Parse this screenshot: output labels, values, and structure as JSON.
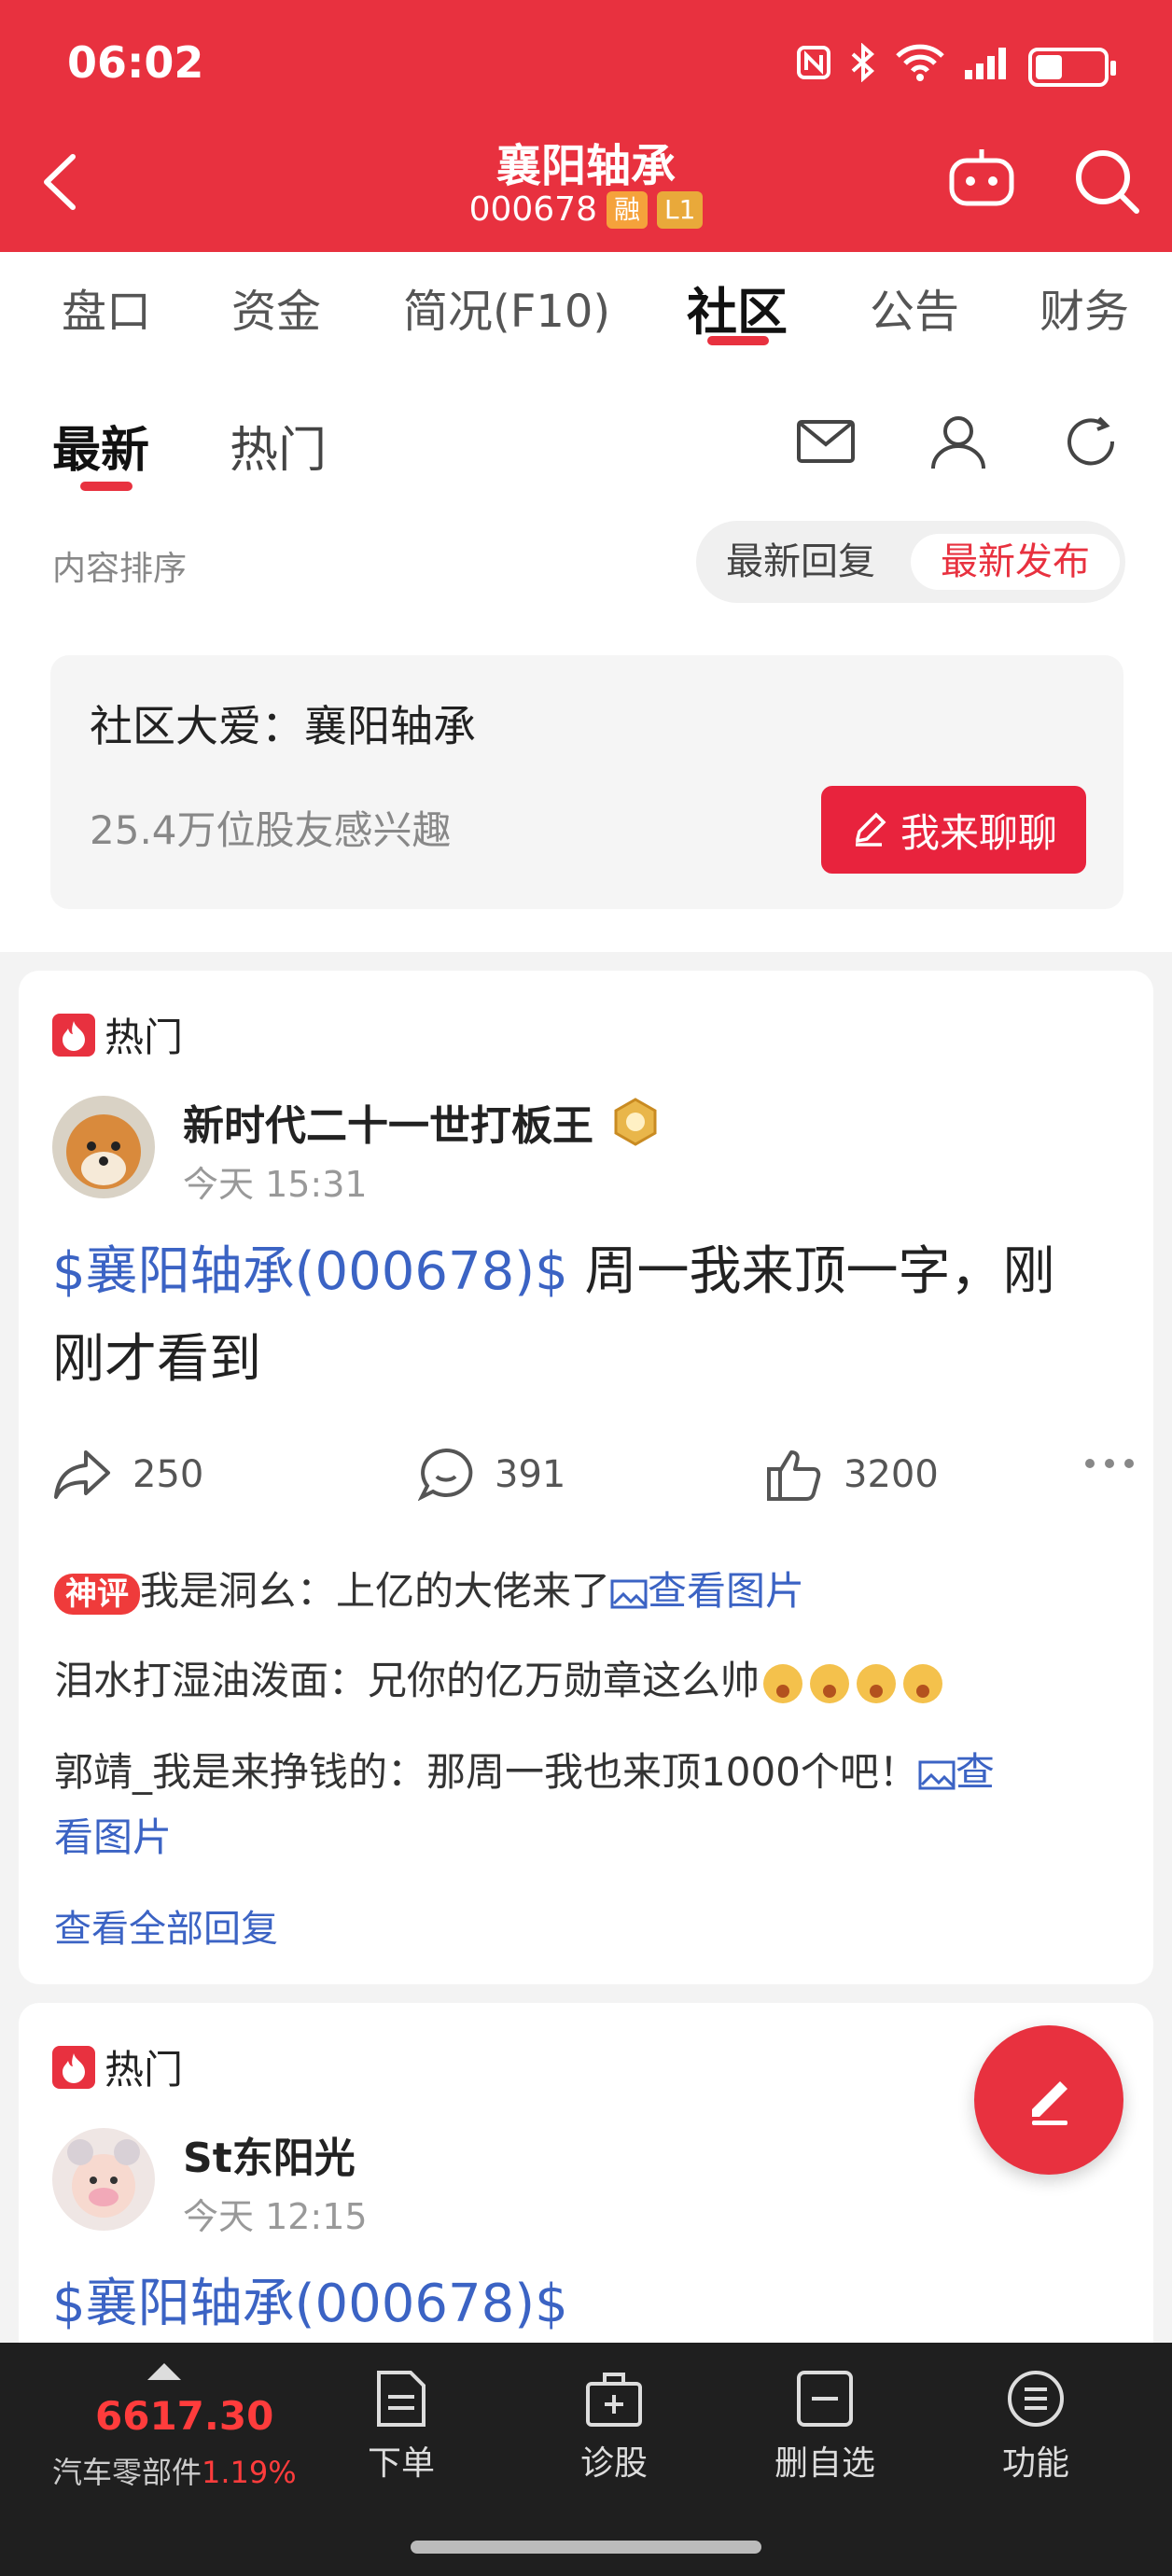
{
  "status_bar": {
    "time": "06:02"
  },
  "header": {
    "title": "襄阳轴承",
    "code": "000678",
    "badge_margin": "融",
    "badge_level": "L1"
  },
  "tabs": [
    "盘口",
    "资金",
    "简况(F10)",
    "社区",
    "公告",
    "财务"
  ],
  "active_tab": "社区",
  "subtabs": {
    "latest": "最新",
    "hot": "热门"
  },
  "sort": {
    "label": "内容排序",
    "option_reply": "最新回复",
    "option_publish": "最新发布",
    "selected": "最新发布"
  },
  "community_card": {
    "title": "社区大爱：襄阳轴承",
    "interest": "25.4万位股友感兴趣",
    "chat_button": "我来聊聊"
  },
  "posts": [
    {
      "tag": "热门",
      "author": "新时代二十一世打板王",
      "time": "今天 15:31",
      "stock_link": "$襄阳轴承(000678)$",
      "text_line1": " 周一我来顶一字，刚",
      "text_line2": "刚才看到",
      "shares": "250",
      "comments": "391",
      "likes": "3200",
      "replies": [
        {
          "badge": "神评",
          "user": "我是洞幺",
          "text": "：上亿的大佬来了",
          "link": "查看图片"
        },
        {
          "user": "泪水打湿油泼面",
          "text": "：兄你的亿万勋章这么帅"
        },
        {
          "user": "郭靖_我是来挣钱的",
          "text": "：那周一我也来顶1000个吧！",
          "link_a": "查",
          "link_b": "看图片"
        }
      ],
      "view_all": "查看全部回复"
    },
    {
      "tag": "热门",
      "author": "St东阳光",
      "time": "今天 12:15",
      "stock_link": "$襄阳轴承(000678)$"
    }
  ],
  "bottom_bar": {
    "index_value": "6617.30",
    "index_name": "汽车零部件",
    "index_change": "1.19%",
    "nav": [
      "下单",
      "诊股",
      "删自选",
      "功能"
    ]
  },
  "colors": {
    "brand": "#e8313f",
    "link": "#3b63c4"
  }
}
